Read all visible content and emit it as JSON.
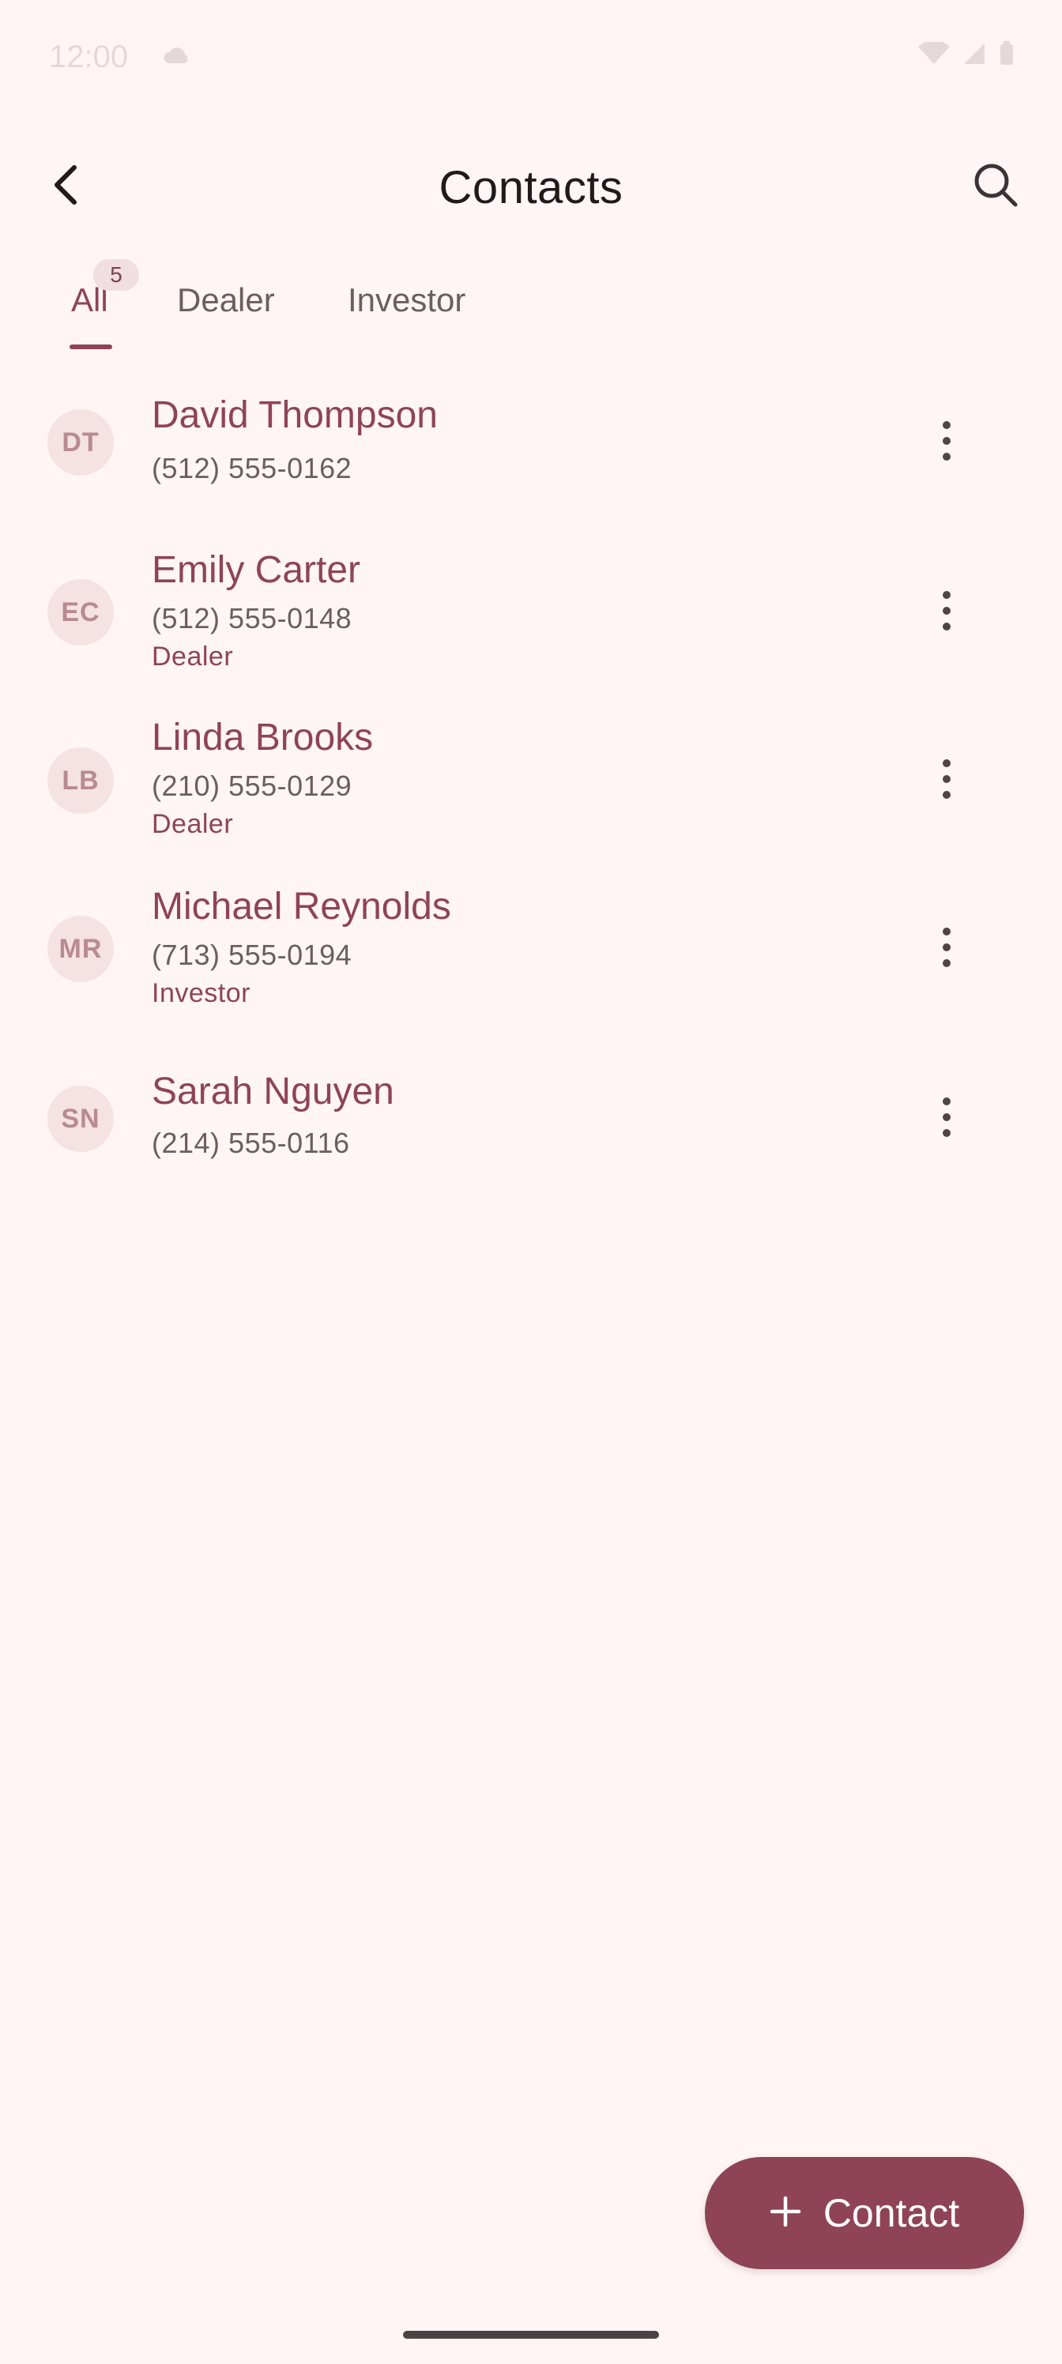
{
  "status_bar": {
    "time": "12:00"
  },
  "app_bar": {
    "title": "Contacts",
    "back_icon": "chevron-left-icon",
    "search_icon": "search-icon"
  },
  "tabs": [
    {
      "label": "All",
      "badge": "5",
      "active": true
    },
    {
      "label": "Dealer",
      "active": false
    },
    {
      "label": "Investor",
      "active": false
    }
  ],
  "contacts": [
    {
      "initials": "DT",
      "name": "David Thompson",
      "phone": "(512) 555-0162",
      "tag": ""
    },
    {
      "initials": "EC",
      "name": "Emily Carter",
      "phone": "(512) 555-0148",
      "tag": "Dealer"
    },
    {
      "initials": "LB",
      "name": "Linda Brooks",
      "phone": "(210) 555-0129",
      "tag": "Dealer"
    },
    {
      "initials": "MR",
      "name": "Michael Reynolds",
      "phone": "(713) 555-0194",
      "tag": "Investor"
    },
    {
      "initials": "SN",
      "name": "Sarah Nguyen",
      "phone": "(214) 555-0116",
      "tag": ""
    }
  ],
  "fab": {
    "label": "Contact",
    "icon": "plus-icon"
  },
  "colors": {
    "background": "#FFF5F4",
    "accent": "#8E4456",
    "avatar_bg": "#F5E2E3",
    "secondary_text": "#6B5E60"
  }
}
